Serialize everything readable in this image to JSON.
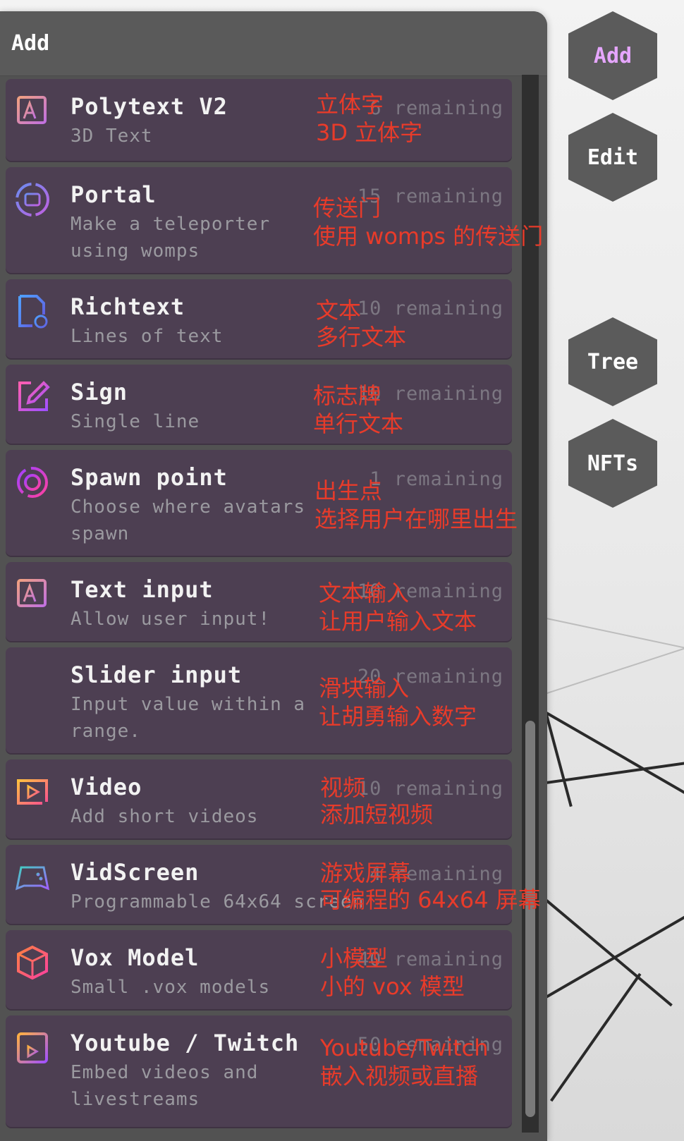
{
  "panel": {
    "title": "Add"
  },
  "hex_buttons": [
    {
      "label": "Add",
      "active": true
    },
    {
      "label": "Edit"
    },
    {
      "label": "Tree"
    },
    {
      "label": "NFTs"
    }
  ],
  "items": [
    {
      "title": "Polytext V2",
      "desc": "3D Text",
      "remaining": "6 remaining",
      "icon": "text-frame-icon",
      "cn1": "立体字",
      "cn2": "3D 立体字"
    },
    {
      "title": "Portal",
      "desc": "Make a teleporter using womps",
      "remaining": "15 remaining",
      "icon": "portal-icon",
      "cn1": "传送门",
      "cn2": "使用 womps 的传送门"
    },
    {
      "title": "Richtext",
      "desc": "Lines of text",
      "remaining": "10 remaining",
      "icon": "richtext-icon",
      "cn1": "文本",
      "cn2": "多行文本"
    },
    {
      "title": "Sign",
      "desc": "Single line",
      "remaining": "10 remaining",
      "icon": "sign-edit-icon",
      "cn1": "标志牌",
      "cn2": "单行文本"
    },
    {
      "title": "Spawn point",
      "desc": "Choose where avatars spawn",
      "remaining": "1 remaining",
      "icon": "spawn-point-icon",
      "cn1": "出生点",
      "cn2": "选择用户在哪里出生"
    },
    {
      "title": "Text input",
      "desc": "Allow user input!",
      "remaining": "10 remaining",
      "icon": "text-input-icon",
      "cn1": "文本输入",
      "cn2": "让用户输入文本"
    },
    {
      "title": "Slider input",
      "desc": "Input value within a range.",
      "remaining": "20 remaining",
      "icon": "slider-icon",
      "cn1": "滑块输入",
      "cn2": "让胡勇输入数字"
    },
    {
      "title": "Video",
      "desc": "Add short videos",
      "remaining": "10 remaining",
      "icon": "video-icon",
      "cn1": "视频",
      "cn2": "添加短视频"
    },
    {
      "title": "VidScreen",
      "desc": "Programmable 64x64 screen",
      "remaining": "4 remaining",
      "icon": "gamepad-icon",
      "cn1": "游戏屏幕",
      "cn2": "可编程的 64x64 屏幕"
    },
    {
      "title": "Vox Model",
      "desc": "Small .vox models",
      "remaining": "40 remaining",
      "icon": "vox-cube-icon",
      "cn1": "小模型",
      "cn2": "小的 vox 模型"
    },
    {
      "title": "Youtube / Twitch",
      "desc": "Embed videos and livestreams",
      "remaining": "50 remaining",
      "icon": "stream-icon",
      "cn1": "Youtube/Twitch",
      "cn2": "嵌入视频或直播"
    }
  ],
  "colors": {
    "accent_text": "#e83b2a",
    "card_bg": "#4d3f52",
    "panel_bg": "#525252",
    "active_hex_text": "#e6a6ff"
  }
}
